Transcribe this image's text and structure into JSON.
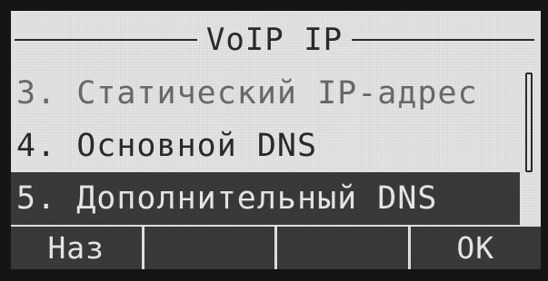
{
  "title": "VoIP IP",
  "menu": {
    "items": [
      {
        "label": "3. Статический IP-адрес"
      },
      {
        "label": "4. Основной DNS"
      },
      {
        "label": "5. Дополнительный DNS"
      }
    ]
  },
  "softkeys": {
    "back": "Наз",
    "key2": "",
    "key3": "",
    "ok": "OK"
  },
  "colors": {
    "lcd_background": "#e4e4e4",
    "lcd_text": "#2a2a2a",
    "selection": "#3a3a3a"
  }
}
